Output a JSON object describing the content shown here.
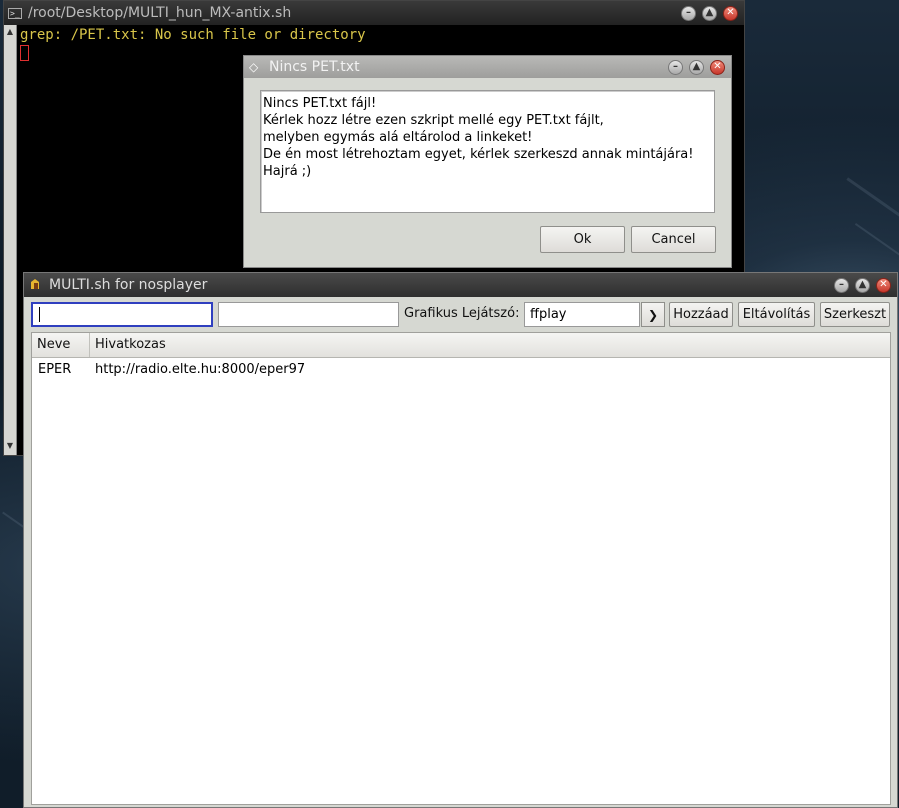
{
  "terminal": {
    "title": "/root/Desktop/MULTI_hun_MX-antix.sh",
    "output_line": "grep: /PET.txt: No such file or directory"
  },
  "dialog": {
    "title": "Nincs PET.txt",
    "message_lines": [
      "Nincs PET.txt fájl!",
      "Kérlek hozz létre ezen szkript mellé egy PET.txt fájlt,",
      "melyben egymás alá eltárolod a linkeket!",
      "De én most létrehoztam egyet, kérlek szerkeszd annak mintájára!",
      "Hajrá ;)"
    ],
    "ok_label": "Ok",
    "cancel_label": "Cancel"
  },
  "main_window": {
    "title": "MULTI.sh for nosplayer",
    "name_input_value": "",
    "link_input_value": "",
    "player_label": "Grafikus Lejátszó:",
    "player_value": "ffplay",
    "add_label": "Hozzáad",
    "remove_label": "Eltávolítás",
    "edit_label": "Szerkeszt",
    "columns": [
      "Neve",
      "Hivatkozas"
    ],
    "rows": [
      {
        "name": "EPER",
        "link": "http://radio.elte.hu:8000/eper97"
      }
    ]
  },
  "window_controls": {
    "minimize": "–",
    "maximize": "▲",
    "close": "✕"
  },
  "icons": {
    "terminal_icon": "terminal-icon",
    "dialog_icon": "diamond-icon",
    "app_icon": "house-icon",
    "dropdown_icon": "chevron-down-icon"
  },
  "colors": {
    "terminal_text": "#d9c64a",
    "focus_border": "#2f3fbf",
    "close_button": "#c7362a"
  }
}
